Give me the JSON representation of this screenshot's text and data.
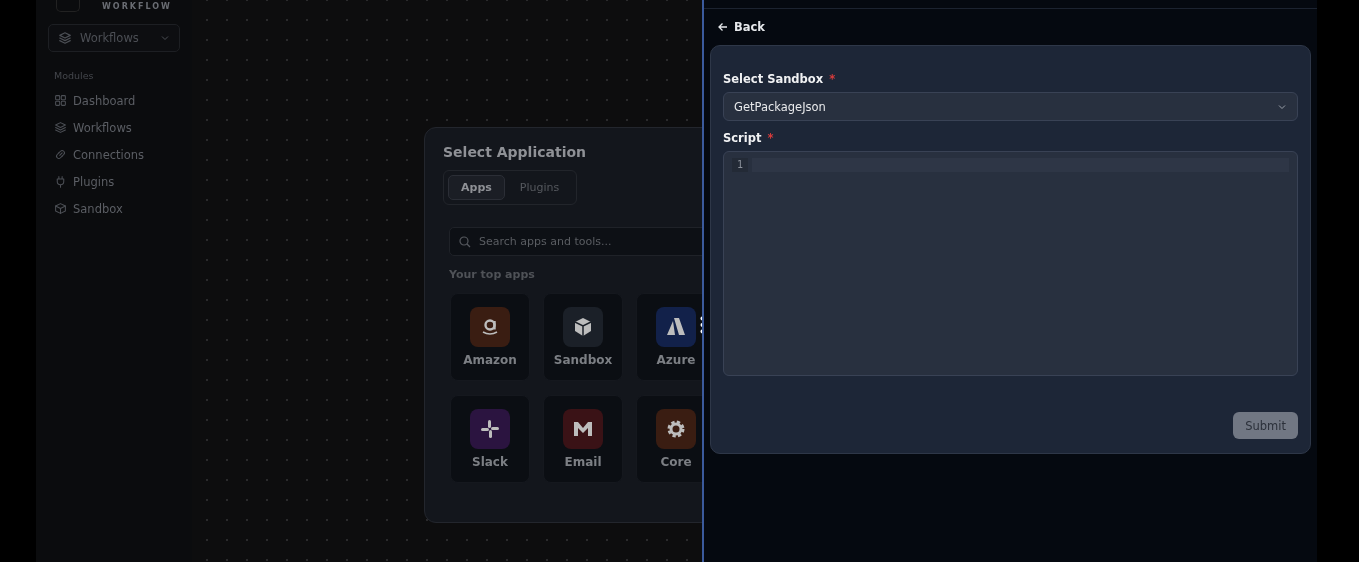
{
  "logo": {
    "text": "WORKFLOW"
  },
  "sidebar": {
    "dropdown": "Workflows",
    "section": "Modules",
    "items": [
      {
        "label": "Dashboard",
        "kind": "grid"
      },
      {
        "label": "Workflows",
        "kind": "layers"
      },
      {
        "label": "Connections",
        "kind": "link"
      },
      {
        "label": "Plugins",
        "kind": "plug"
      },
      {
        "label": "Sandbox",
        "kind": "cube"
      }
    ]
  },
  "modal": {
    "title": "Select Application",
    "tabs": [
      {
        "label": "Apps",
        "selected": true
      },
      {
        "label": "Plugins",
        "selected": false
      }
    ],
    "search": {
      "placeholder": "Search apps and tools..."
    },
    "section": "Your top apps",
    "apps": [
      {
        "name": "Amazon",
        "kind": "amazon",
        "color": "#3a1d12"
      },
      {
        "name": "Sandbox",
        "kind": "cube",
        "color": "#1b2028"
      },
      {
        "name": "Azure",
        "kind": "azure",
        "color": "#12214a"
      },
      {
        "name": "Slack",
        "kind": "slack",
        "color": "#2b1440"
      },
      {
        "name": "Email",
        "kind": "mail",
        "color": "#3a1216"
      },
      {
        "name": "Core",
        "kind": "gear",
        "color": "#3a1d12"
      }
    ]
  },
  "panel": {
    "back": "Back",
    "sandbox": {
      "label": "Select Sandbox",
      "required_mark": "*",
      "value": "GetPackageJson"
    },
    "script": {
      "label": "Script",
      "required_mark": "*",
      "line_number": "1"
    },
    "submit": "Submit"
  }
}
